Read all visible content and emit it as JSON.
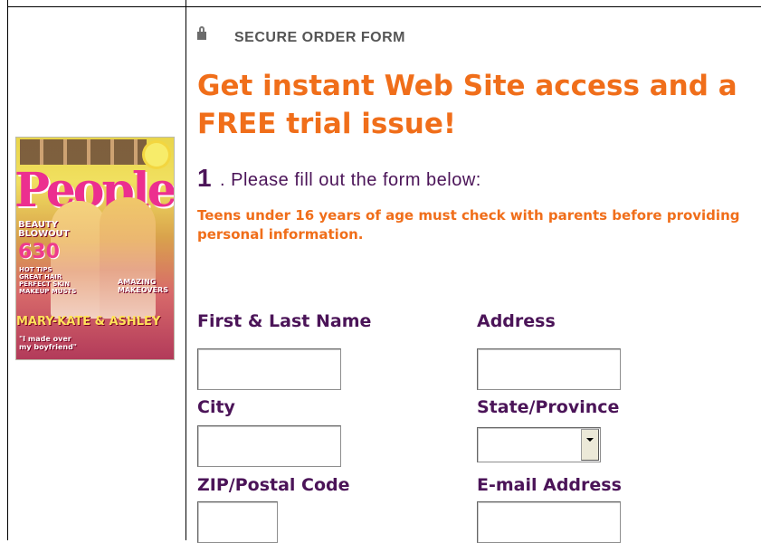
{
  "header": {
    "secure_label": "SECURE ORDER FORM",
    "headline": "Get instant Web Site access and a FREE trial issue!"
  },
  "step": {
    "number": "1",
    "text": ". Please fill out the form below:"
  },
  "warning": "Teens under 16 years of age must check with parents before providing personal information.",
  "fields": {
    "name_label": "First & Last Name",
    "address_label": "Address",
    "city_label": "City",
    "state_label": "State/Province",
    "zip_label": "ZIP/Postal Code",
    "email_label": "E-mail Address",
    "name_value": "",
    "address_value": "",
    "city_value": "",
    "state_value": "",
    "zip_value": "",
    "email_value": ""
  },
  "colors": {
    "accent_orange": "#f06e1a",
    "label_purple": "#4b1458"
  },
  "icons": {
    "secure": "lock-icon",
    "select": "chevron-down-icon"
  }
}
